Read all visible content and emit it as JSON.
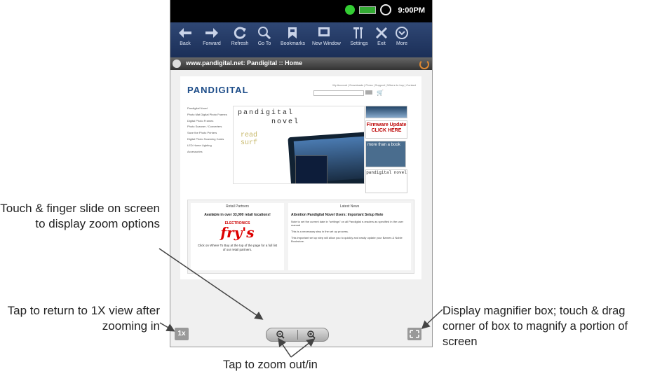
{
  "status_bar": {
    "time": "9:00PM",
    "icons": [
      "wifi-icon",
      "battery-icon",
      "alarm-icon"
    ]
  },
  "toolbar": {
    "items": [
      {
        "label": "Back",
        "icon": "back-arrow-icon"
      },
      {
        "label": "Forward",
        "icon": "forward-arrow-icon"
      },
      {
        "label": "Refresh",
        "icon": "refresh-icon"
      },
      {
        "label": "Go To",
        "icon": "search-icon"
      },
      {
        "label": "Bookmarks",
        "icon": "bookmark-icon"
      },
      {
        "label": "New Window",
        "icon": "new-window-icon"
      },
      {
        "label": "Settings",
        "icon": "settings-icon"
      },
      {
        "label": "Exit",
        "icon": "close-icon"
      },
      {
        "label": "More",
        "icon": "more-icon"
      }
    ]
  },
  "url_bar": {
    "title": "www.pandigital.net: Pandigital :: Home"
  },
  "webpage": {
    "logo": "PANDIGITAL",
    "top_links": "My Account | Downloads | Press | Support | Where to buy | Contact",
    "nav": [
      "Pandigital Novel",
      "Photo Mat Digital Photo Frames",
      "Digital Photo Frames",
      "Photo Scanner / Converters",
      "Save the Photo Printers",
      "Digital Photo Scanning Cards",
      "LED Home Lighting",
      "Accessories"
    ],
    "hero": {
      "line1": "pandigital",
      "line2": "novel",
      "line3": "read",
      "line4": "surf"
    },
    "promos": {
      "firmware": "Firmware Update CLICK HERE",
      "more": "more than a book",
      "novel_small": "pandigital novel"
    },
    "retail": {
      "header": "Retail Partners",
      "headline": "Available in over 33,000 retail locations!",
      "brand_top": "ELECTRONICS",
      "brand": "fry's",
      "footer": "Click on Where To Buy at the top of the page for a full list of our retail partners."
    },
    "news": {
      "header": "Latest News",
      "title": "Attention Pandigital Novel Users: Important Setup Note",
      "paragraphs": [
        "Note to set the current date in \"settings\" on all Pandigital e-readers as specified in the user manual",
        "This is a necessary step in the set up process.",
        "This important set up step will allow you to quickly and easily update your Barnes & Noble Bookstore."
      ]
    }
  },
  "bottom_controls": {
    "one_x_label": "1x"
  },
  "callouts": {
    "touch_slide": "Touch & finger slide on screen to display zoom options",
    "return_1x": "Tap to return to 1X view after zooming in",
    "magnifier": "Display magnifier box; touch & drag corner of box to magnify a portion of screen",
    "zoom": "Tap to zoom out/in"
  }
}
